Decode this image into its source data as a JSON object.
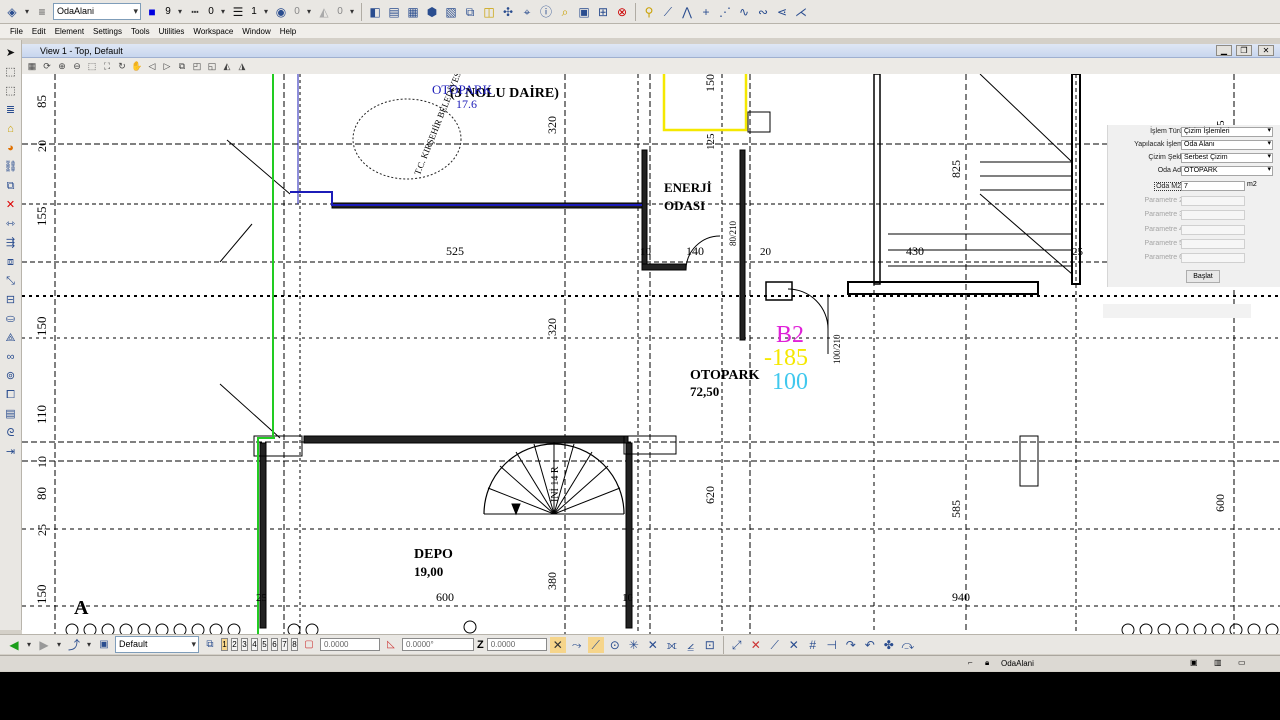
{
  "toolbar": {
    "level_value": "OdaAlani",
    "color_value": "9",
    "style_value": "0",
    "weight_value": "1",
    "transparency_value": "0",
    "priority_value": "0"
  },
  "menu": {
    "items": [
      "File",
      "Edit",
      "Element",
      "Settings",
      "Tools",
      "Utilities",
      "Workspace",
      "Window",
      "Help"
    ]
  },
  "view": {
    "title": "View 1 - Top, Default"
  },
  "drawing": {
    "room_labels": [
      {
        "text": "OTOPARK",
        "sub": "72,50"
      },
      {
        "text": "DEPO",
        "sub": "19,00"
      },
      {
        "text": "ENERJİ",
        "sub": "ODASI"
      },
      {
        "text": "(3 NOLU DAİRE)"
      }
    ],
    "overlay_text": {
      "b2": "B2",
      "minus": "-185",
      "hundred": "100",
      "blue_label": "OTOPARK",
      "blue_value": "17.6"
    },
    "stair_label": "İNİ 14 R",
    "grid_mark": "A",
    "dim_top": [
      "525",
      "140",
      "430",
      "10",
      "20",
      "25",
      "10",
      "25"
    ],
    "dim_bottom": [
      "600",
      "940",
      "25",
      "10"
    ],
    "dim_left": [
      "85",
      "20",
      "155",
      "150",
      "110",
      "10",
      "80",
      "25",
      "150"
    ],
    "dim_vertical": [
      "320",
      "320",
      "620",
      "380",
      "150",
      "825",
      "585",
      "600",
      "80/210",
      "100/210",
      "125",
      "5"
    ],
    "stamp_text": "T.C. KIRŞEHİR BELEDİYESİ İMAR VE ŞEHİRCİLİK MÜD."
  },
  "props": {
    "islem_turu_label": "İşlem Türü",
    "islem_turu_value": "Çizim İşlemleri",
    "yapilacak_label": "Yapılacak İşlem",
    "yapilacak_value": "Oda Alanı",
    "cizim_sekli_label": "Çizim Şekli",
    "cizim_sekli_value": "Serbest Çizim",
    "oda_adi_label": "Oda Adı",
    "oda_adi_value": "OTOPARK",
    "oda_m2_label": "Oda M2",
    "oda_m2_value": "7",
    "unit": "m2",
    "param2_label": "Parametre 2",
    "param3_label": "Parametre 3",
    "param4_label": "Parametre 4",
    "param5_label": "Parametre 5",
    "param6_label": "Parametre 6",
    "start_label": "Başlat"
  },
  "accudraw": {
    "view_buttons": [
      "1",
      "2",
      "3",
      "4",
      "5",
      "6",
      "7",
      "8"
    ],
    "x_value": "0.0000",
    "angle_value": "0.0000°",
    "z_label": "Z",
    "z_value": "0.0000",
    "display_style": "Default"
  },
  "status": {
    "active_model": "OdaAlani"
  },
  "colors": {
    "magenta": "#e020d8",
    "yellow": "#f5e800",
    "cyan": "#40c8ee",
    "blue": "#1c1cb8",
    "green": "#22cc22"
  }
}
